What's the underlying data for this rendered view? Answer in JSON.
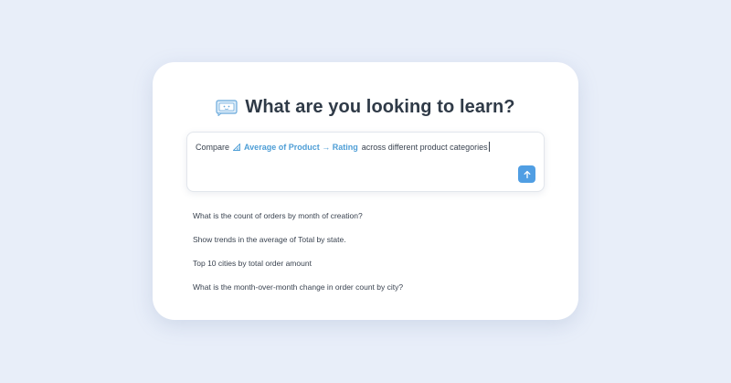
{
  "header": {
    "title": "What are you looking to learn?",
    "icon": "chat-bot-icon"
  },
  "query": {
    "prefix": "Compare",
    "metric_icon": "metric-icon",
    "metric_label": "Average of Product → Rating",
    "suffix": "across different product categories",
    "send_icon": "arrow-up-icon"
  },
  "suggestions": [
    "What is the count of orders by month of creation?",
    "Show trends in the average of Total by state.",
    "Top 10 cities by total order amount",
    "What is the month-over-month change in order count by city?"
  ],
  "colors": {
    "background": "#e8eef9",
    "card": "#ffffff",
    "accent": "#509ee3",
    "metric_text": "#4e9ed6",
    "title_text": "#2f3a47",
    "body_text": "#3a4350"
  }
}
